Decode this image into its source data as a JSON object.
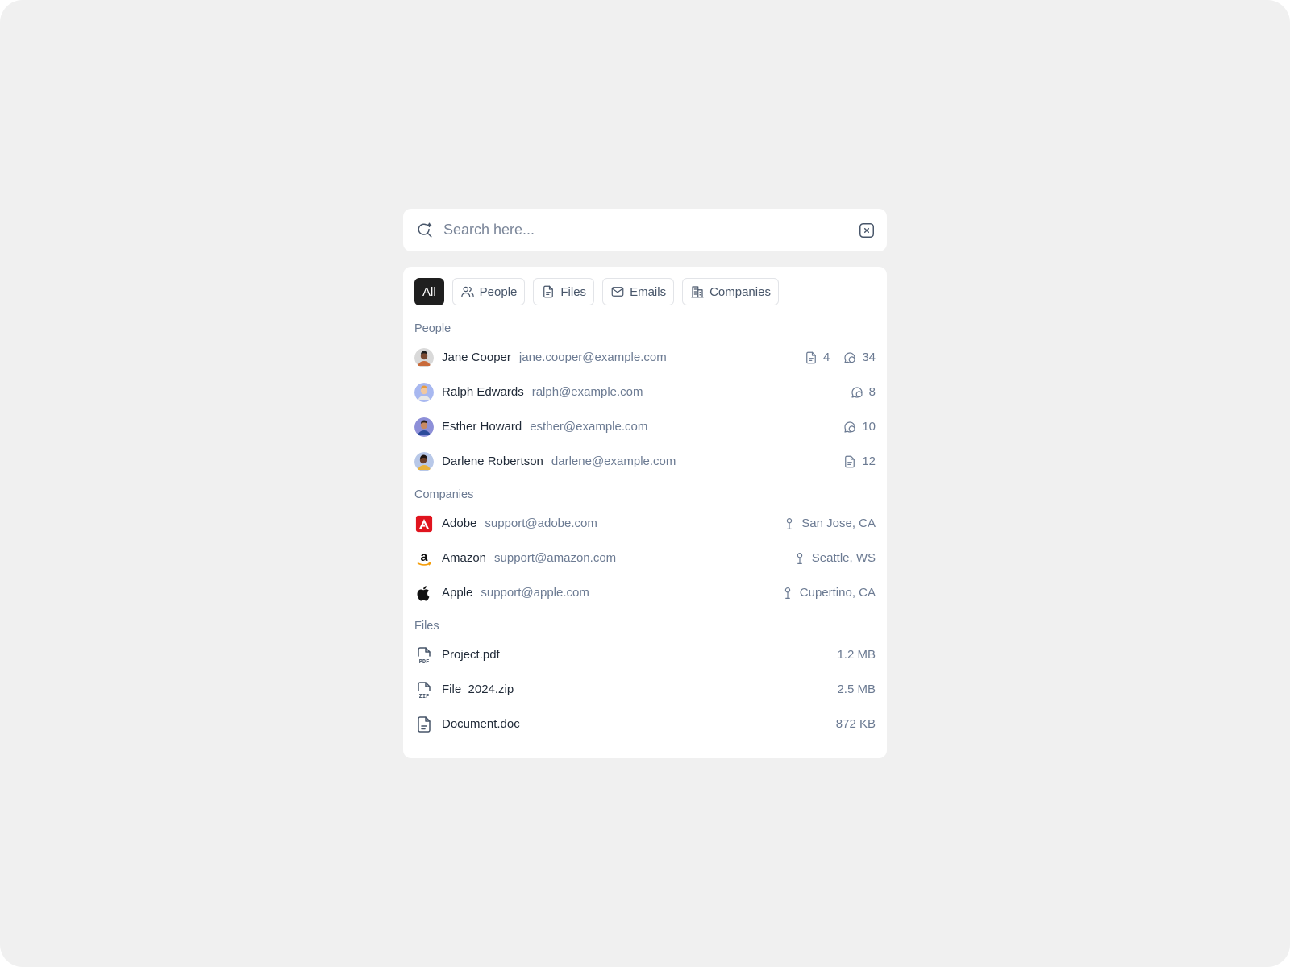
{
  "search": {
    "placeholder": "Search here..."
  },
  "tabs": [
    {
      "label": "All",
      "icon": "none",
      "active": true
    },
    {
      "label": "People",
      "icon": "users-icon",
      "active": false
    },
    {
      "label": "Files",
      "icon": "file-icon",
      "active": false
    },
    {
      "label": "Emails",
      "icon": "mail-icon",
      "active": false
    },
    {
      "label": "Companies",
      "icon": "building-icon",
      "active": false
    }
  ],
  "sections": {
    "people": {
      "label": "People",
      "items": [
        {
          "name": "Jane Cooper",
          "email": "jane.cooper@example.com",
          "files": "4",
          "messages": "34"
        },
        {
          "name": "Ralph Edwards",
          "email": "ralph@example.com",
          "messages": "8"
        },
        {
          "name": "Esther Howard",
          "email": "esther@example.com",
          "messages": "10"
        },
        {
          "name": "Darlene Robertson",
          "email": "darlene@example.com",
          "files": "12"
        }
      ]
    },
    "companies": {
      "label": "Companies",
      "items": [
        {
          "name": "Adobe",
          "email": "support@adobe.com",
          "location": "San Jose, CA",
          "logo": "adobe-logo-icon"
        },
        {
          "name": "Amazon",
          "email": "support@amazon.com",
          "location": "Seattle, WS",
          "logo": "amazon-logo-icon"
        },
        {
          "name": "Apple",
          "email": "support@apple.com",
          "location": "Cupertino, CA",
          "logo": "apple-logo-icon"
        }
      ]
    },
    "files": {
      "label": "Files",
      "items": [
        {
          "name": "Project.pdf",
          "size": "1.2 MB",
          "icon": "pdf-file-icon",
          "badge": "PDF"
        },
        {
          "name": "File_2024.zip",
          "size": "2.5 MB",
          "icon": "zip-file-icon",
          "badge": "ZIP"
        },
        {
          "name": "Document.doc",
          "size": "872 KB",
          "icon": "doc-file-icon"
        }
      ]
    }
  },
  "colors": {
    "background": "#f0f0f0",
    "panel": "#ffffff",
    "active_tab": "#1f1f1f",
    "muted_text": "#6b7a92",
    "adobe_red": "#e0141e",
    "amazon_orange": "#f59e0b"
  }
}
